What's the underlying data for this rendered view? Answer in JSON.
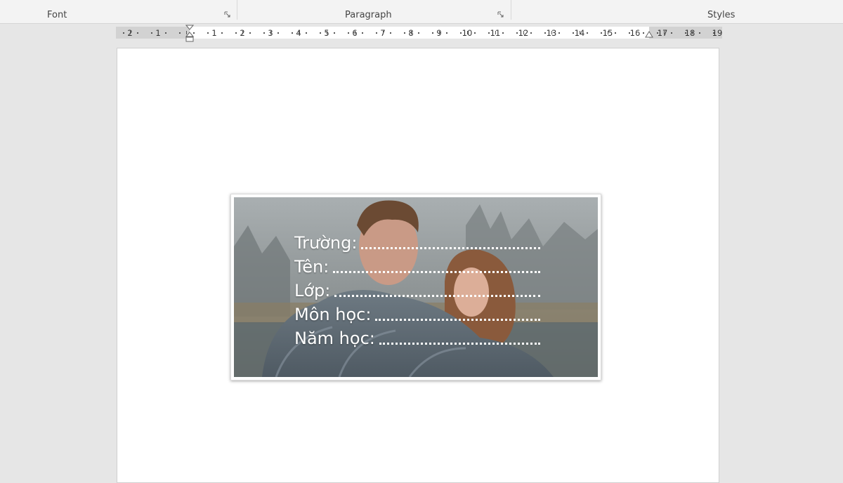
{
  "ribbon": {
    "groups": [
      {
        "label": "Font"
      },
      {
        "label": "Paragraph"
      },
      {
        "label": "Styles"
      }
    ],
    "icons": {
      "launcher": "dialog-launcher-icon"
    }
  },
  "ruler": {
    "left_margin_numbers": [
      "2",
      "1"
    ],
    "numbers": [
      "1",
      "2",
      "3",
      "4",
      "5",
      "6",
      "7",
      "8",
      "9",
      "10",
      "11",
      "12",
      "13",
      "14",
      "15",
      "16",
      "17",
      "18",
      "19"
    ]
  },
  "document": {
    "label_fields": [
      {
        "label": "Trường:"
      },
      {
        "label": "Tên:"
      },
      {
        "label": "Lớp:"
      },
      {
        "label": "Môn học:"
      },
      {
        "label": "Năm học:"
      }
    ]
  }
}
